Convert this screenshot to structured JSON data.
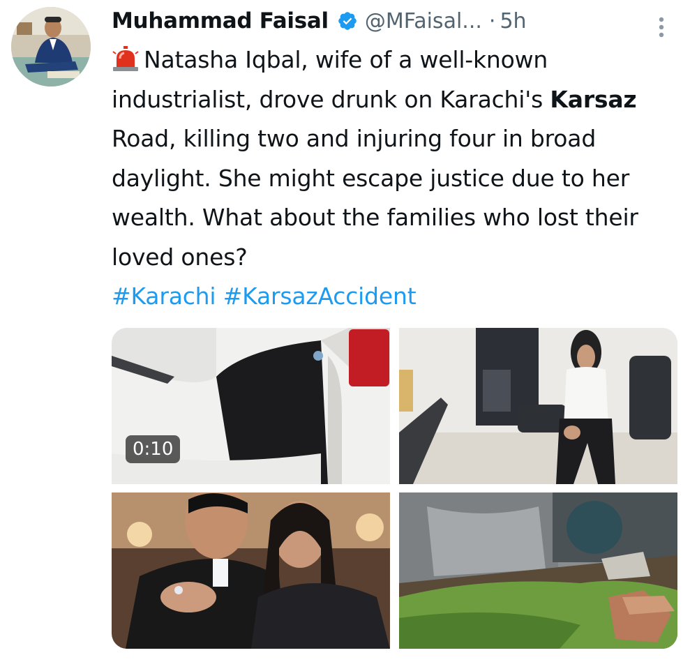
{
  "author": {
    "name": "Muhammad Faisal",
    "handle": "@MFaisal...",
    "separator": "·",
    "time": "5h",
    "verified_icon": "verified-badge-icon",
    "verified_color": "#1d9bf0"
  },
  "tweet": {
    "emoji": "police-siren-icon",
    "text_1": "Natasha Iqbal, wife of a well-known industrialist, drove drunk on Karachi's ",
    "bold": "Karsaz",
    "text_2": " Road, killing two and injuring four in broad daylight. She might escape justice due to her wealth. What about the families who lost their loved ones?",
    "hashtags": "#Karachi #KarsazAccident",
    "hashtag_color": "#1d9bf0"
  },
  "media": {
    "video_duration": "0:10",
    "items": [
      {
        "kind": "video-thumbnail"
      },
      {
        "kind": "photo"
      },
      {
        "kind": "photo"
      },
      {
        "kind": "photo"
      }
    ]
  },
  "colors": {
    "text": "#0f1419",
    "secondary": "#536471",
    "link": "#1d9bf0"
  }
}
